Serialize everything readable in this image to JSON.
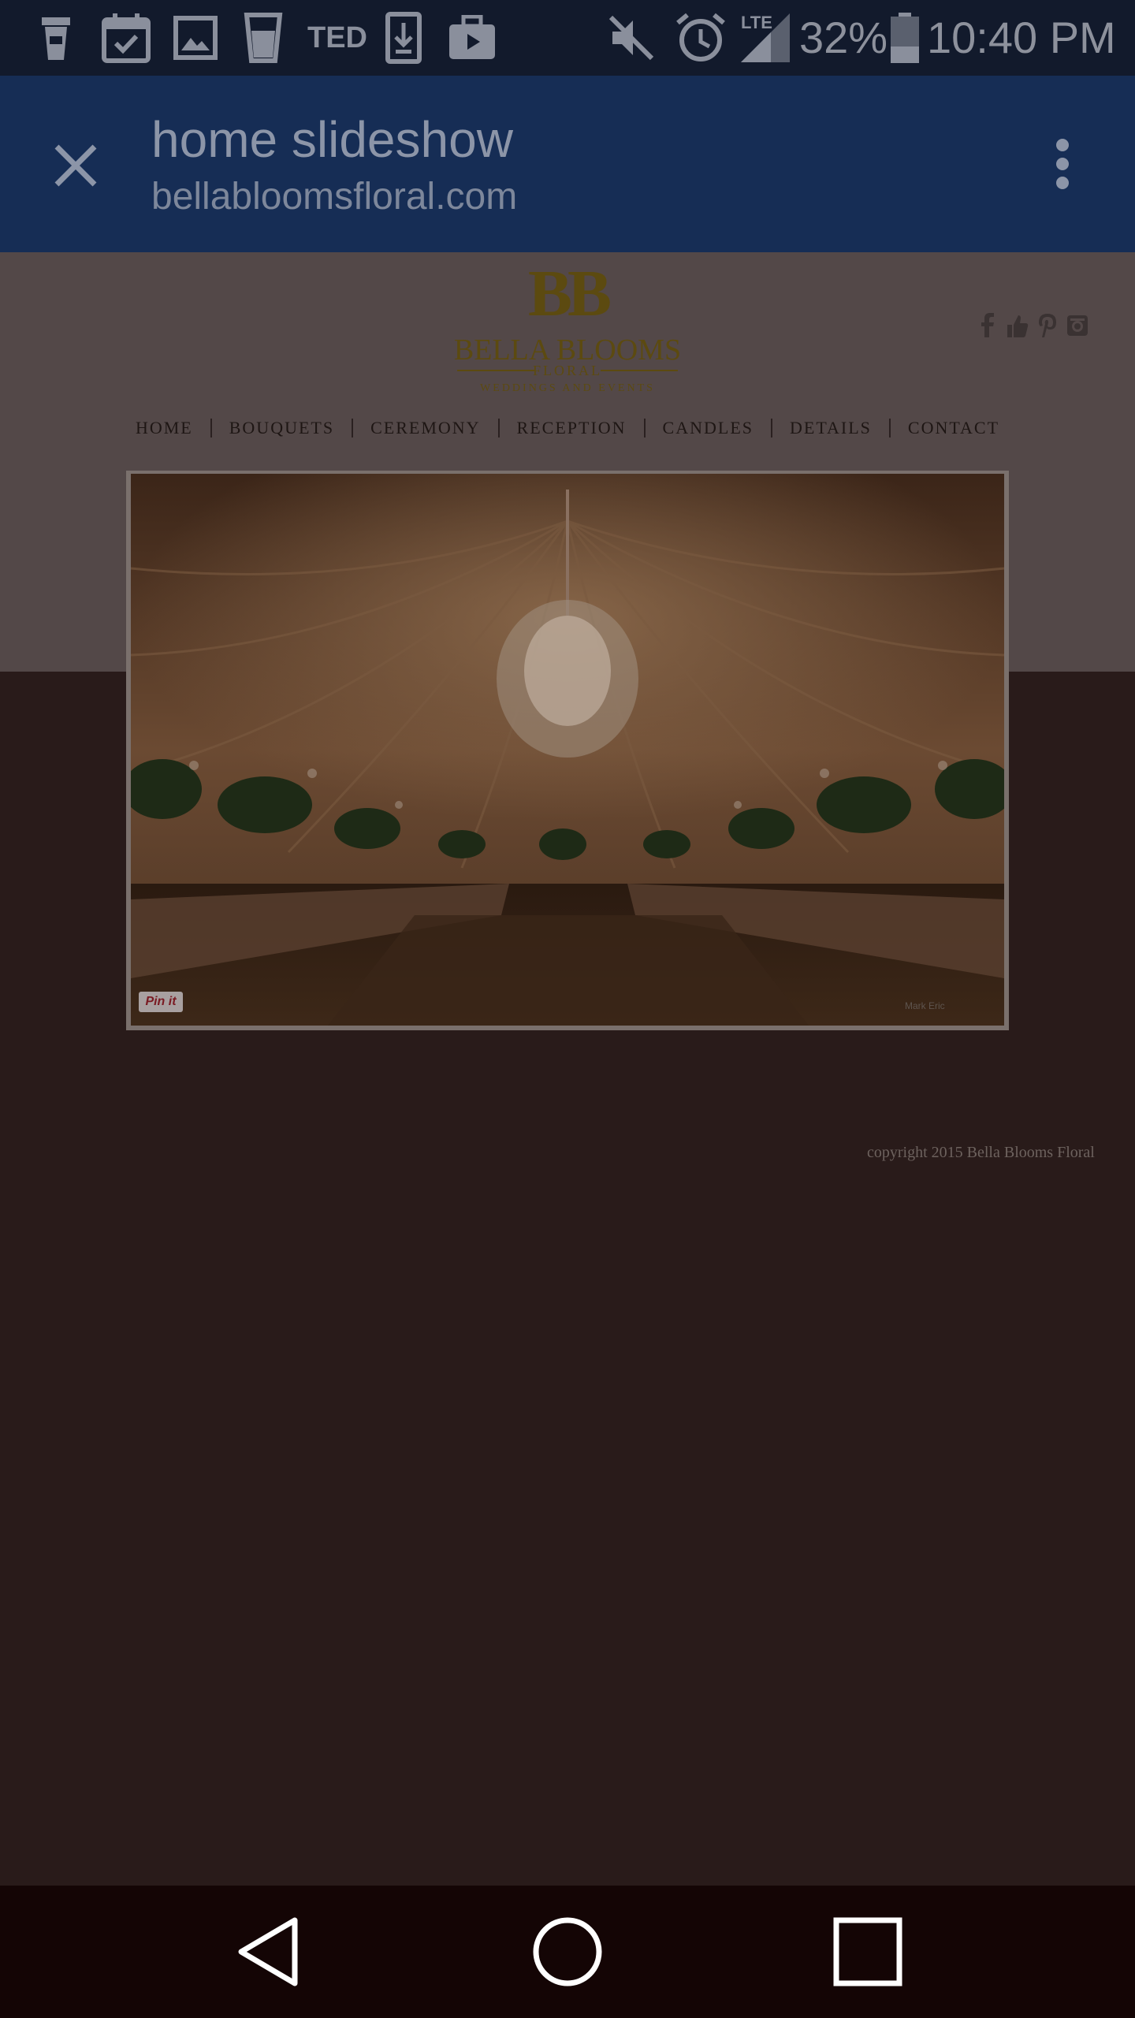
{
  "status_bar": {
    "notification_icons": [
      "coffee-cup-icon",
      "calendar-check-icon",
      "image-icon",
      "glass-icon",
      "ted-icon",
      "download-icon",
      "briefcase-icon"
    ],
    "ted_label": "TED",
    "mute_icon": "mute-icon",
    "alarm_icon": "alarm-icon",
    "network_label": "LTE",
    "battery": "32%",
    "time": "10:40 PM"
  },
  "app_bar": {
    "title": "home slideshow",
    "url": "bellabloomsfloral.com"
  },
  "site": {
    "logo": {
      "monogram": "BB",
      "name": "BELLA BLOOMS",
      "line2": "FLORAL",
      "tagline": "WEDDINGS AND EVENTS"
    },
    "social_icons": [
      "facebook-icon",
      "like-icon",
      "pinterest-icon",
      "instagram-icon"
    ],
    "nav": [
      "HOME",
      "BOUQUETS",
      "CEREMONY",
      "RECEPTION",
      "CANDLES",
      "DETAILS",
      "CONTACT"
    ],
    "slideshow": {
      "pin_label": "Pin it",
      "photo_credit": "Mark Eric"
    },
    "copyright": "copyright 2015 Bella Blooms Floral"
  },
  "colors": {
    "status_bar": "#121a2c",
    "app_bar": "#162d55",
    "page_header": "#534848",
    "page_body": "#291b1a",
    "logo_gold": "#5c4a10",
    "nav_bar": "#140505"
  },
  "system_nav": {
    "buttons": [
      "back-icon",
      "home-icon",
      "recents-icon"
    ]
  }
}
